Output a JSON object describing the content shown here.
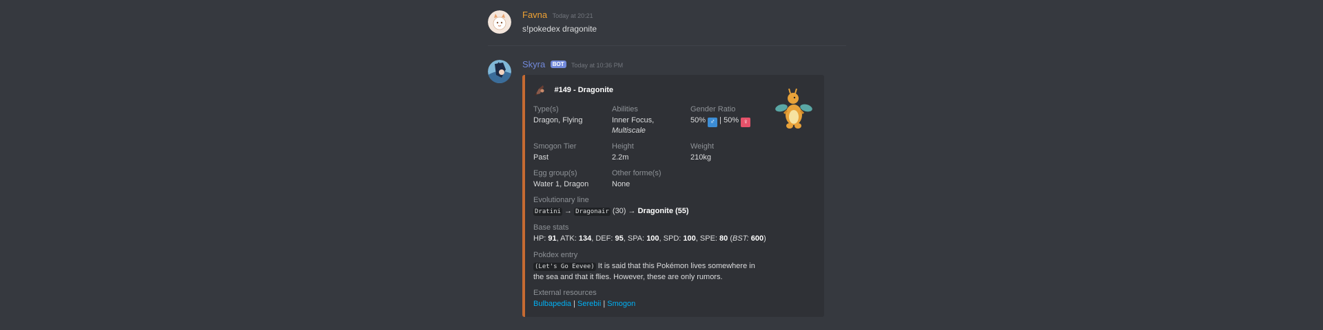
{
  "messages": [
    {
      "username": "Favna",
      "timestamp": "Today at 20:21",
      "content": "s!pokedex dragonite"
    },
    {
      "username": "Skyra",
      "bot_tag": "BOT",
      "timestamp": "Today at 10:36 PM"
    }
  ],
  "embed": {
    "accent_color": "#c56a32",
    "author": "#149 - Dragonite",
    "types": {
      "name": "Type(s)",
      "value": "Dragon, Flying"
    },
    "abilities": {
      "name": "Abilities",
      "value_1": "Inner Focus,",
      "value_2": "Multiscale"
    },
    "gender": {
      "name": "Gender Ratio",
      "male": "50%",
      "male_symbol": "♂",
      "separator": "|",
      "female": "50%",
      "female_symbol": "♀"
    },
    "tier": {
      "name": "Smogon Tier",
      "value": "Past"
    },
    "height": {
      "name": "Height",
      "value": "2.2m"
    },
    "weight": {
      "name": "Weight",
      "value": "210kg"
    },
    "egg_groups": {
      "name": "Egg group(s)",
      "value": "Water 1, Dragon"
    },
    "other_formes": {
      "name": "Other forme(s)",
      "value": "None"
    },
    "evolution": {
      "name": "Evolutionary line",
      "stage1": "Dratini",
      "arrow": "→",
      "stage2": "Dragonair",
      "stage2_level": "(30)",
      "stage3": "Dragonite (55)"
    },
    "base_stats": {
      "name": "Base stats",
      "hp_label": "HP:",
      "hp": "91",
      "atk_label": "ATK:",
      "atk": "134",
      "def_label": "DEF:",
      "def": "95",
      "spa_label": "SPA:",
      "spa": "100",
      "spd_label": "SPD:",
      "spd": "100",
      "spe_label": "SPE:",
      "spe": "80",
      "bst_label": "BST:",
      "bst": "600"
    },
    "dex_entry": {
      "name": "Pokdex entry",
      "game": "(Let's Go Eevee)",
      "text": "It is said that this Pokémon lives somewhere in the sea and that it flies. However, these are only rumors."
    },
    "external": {
      "name": "External resources",
      "links": [
        "Bulbapedia",
        "Serebii",
        "Smogon"
      ],
      "separator": "|"
    }
  }
}
